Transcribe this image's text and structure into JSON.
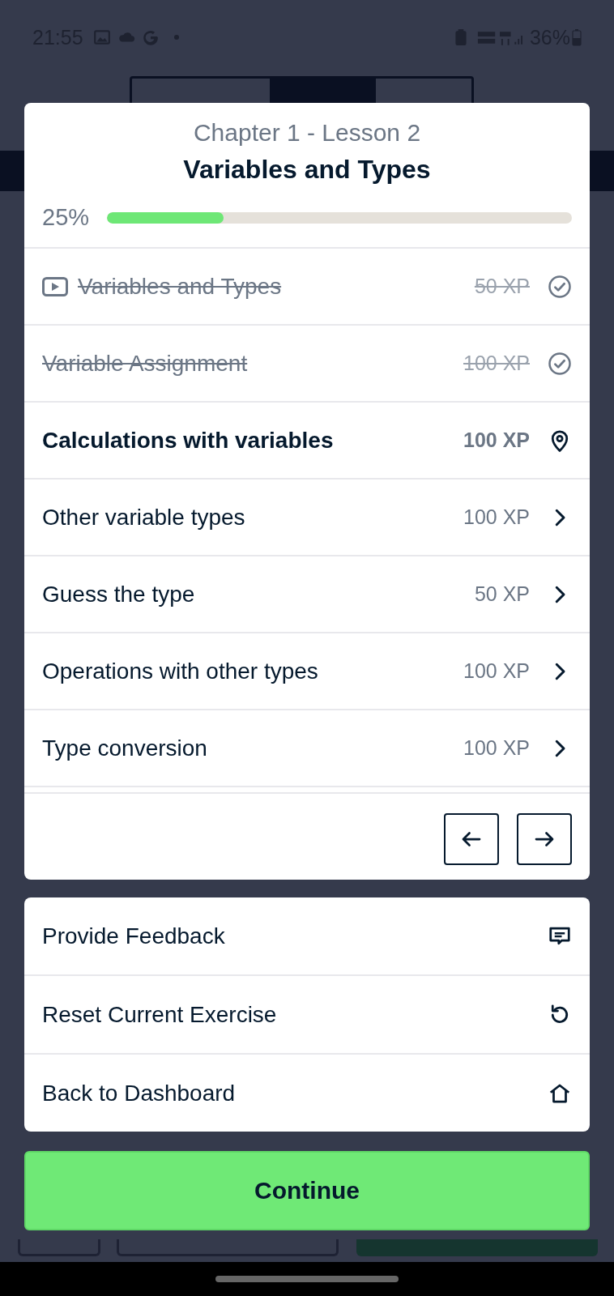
{
  "status_bar": {
    "time": "21:55",
    "battery": "36%"
  },
  "lesson": {
    "chapter": "Chapter 1 - Lesson 2",
    "title": "Variables and Types",
    "progress_text": "25%",
    "level": 0.25
  },
  "exercises": [
    {
      "title": "Variables and Types",
      "xp": "50 XP",
      "kind": "video",
      "completed": true,
      "current": false
    },
    {
      "title": "Variable Assignment",
      "xp": "100 XP",
      "kind": "exercise",
      "completed": true,
      "current": false
    },
    {
      "title": "Calculations with variables",
      "xp": "100 XP",
      "kind": "exercise",
      "completed": false,
      "current": true
    },
    {
      "title": "Other variable types",
      "xp": "100 XP",
      "kind": "exercise",
      "completed": false,
      "current": false
    },
    {
      "title": "Guess the type",
      "xp": "50 XP",
      "kind": "exercise",
      "completed": false,
      "current": false
    },
    {
      "title": "Operations with other types",
      "xp": "100 XP",
      "kind": "exercise",
      "completed": false,
      "current": false
    },
    {
      "title": "Type conversion",
      "xp": "100 XP",
      "kind": "exercise",
      "completed": false,
      "current": false
    }
  ],
  "menu": [
    {
      "label": "Provide Feedback",
      "kind": "feedback"
    },
    {
      "label": "Reset Current Exercise",
      "kind": "reset"
    },
    {
      "label": "Back to Dashboard",
      "kind": "home"
    }
  ],
  "continue_button": "Continue"
}
